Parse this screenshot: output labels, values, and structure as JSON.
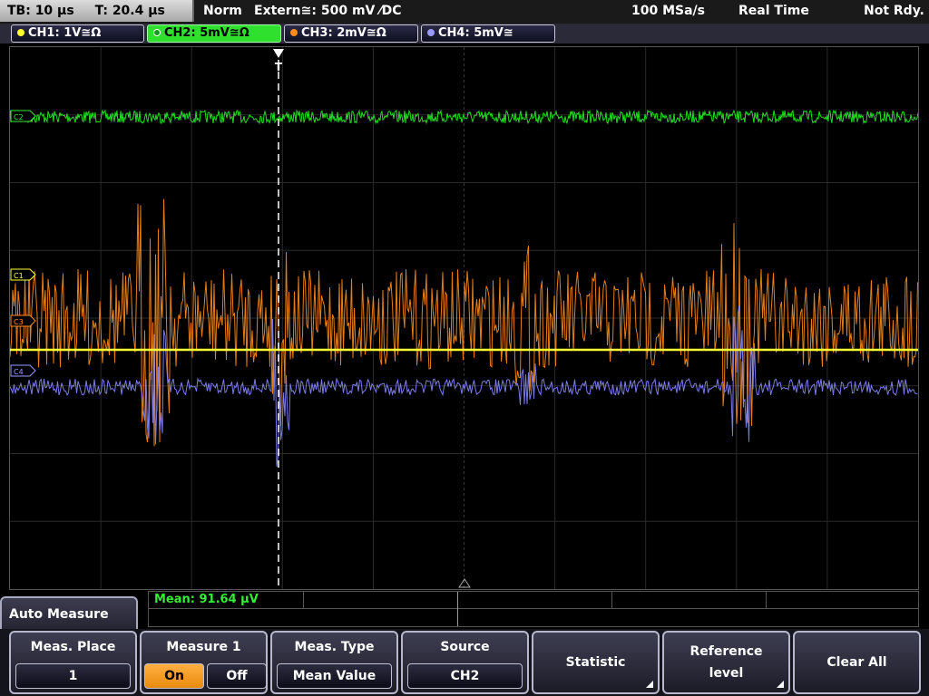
{
  "topbar": {
    "timebase": "TB: 10 µs",
    "trigger_time": "T: 20.4 µs",
    "acq_mode": "Norm",
    "trigger_source": "Extern≅: 500 mV ⁄DC",
    "sample_rate": "100 MSa/s",
    "realtime": "Real Time",
    "status": "Not Rdy."
  },
  "channels": [
    {
      "label": "CH1: 1V≅Ω",
      "color": "#ffff33",
      "active": false
    },
    {
      "label": "CH2: 5mV≅Ω",
      "color": "#33ee33",
      "active": true
    },
    {
      "label": "CH3: 2mV≅Ω",
      "color": "#ff8c1a",
      "active": false
    },
    {
      "label": "CH4: 5mV≅",
      "color": "#9a9aff",
      "active": false
    }
  ],
  "markers": {
    "c1": "C1",
    "c2": "C2",
    "c3": "C3",
    "c4": "C4",
    "trigger": "T"
  },
  "measurement": {
    "result": "Mean: 91.64 µV"
  },
  "menu_title": "Auto Measure",
  "softkeys": {
    "meas_place": {
      "label": "Meas. Place",
      "value": "1"
    },
    "measure1": {
      "label": "Measure 1",
      "on": "On",
      "off": "Off"
    },
    "meas_type": {
      "label": "Meas. Type",
      "value": "Mean Value"
    },
    "source": {
      "label": "Source",
      "value": "CH2"
    },
    "statistic": {
      "label": "Statistic"
    },
    "reference_level": {
      "label": "Reference level"
    },
    "clear_all": {
      "label": "Clear All"
    }
  }
}
